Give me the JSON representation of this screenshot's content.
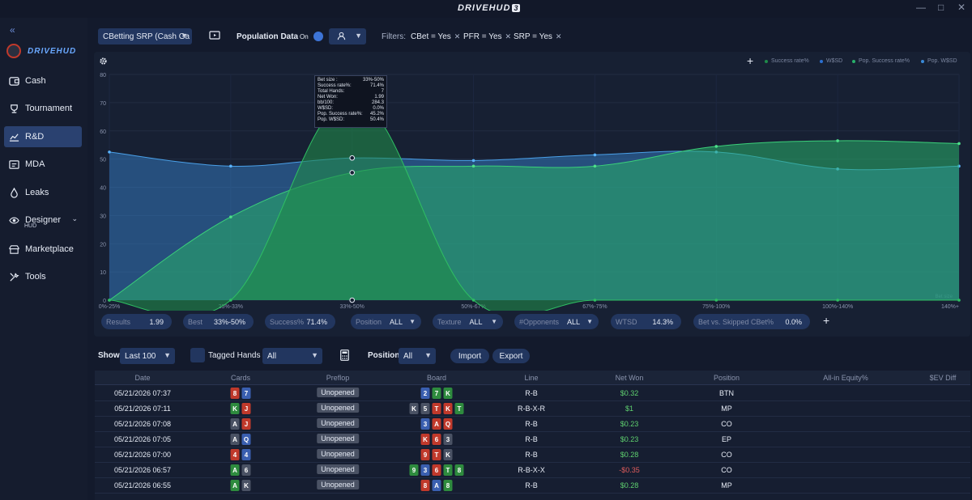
{
  "app": {
    "brand": "DRIVEHUD",
    "brand_version": "3",
    "side_logo_text": "DRIVEHUD"
  },
  "sidebar": {
    "items": [
      {
        "label": "Cash",
        "icon": "cash-icon"
      },
      {
        "label": "Tournament",
        "icon": "trophy-icon"
      },
      {
        "label": "R&D",
        "icon": "chart-icon",
        "active": true
      },
      {
        "label": "MDA",
        "icon": "mda-icon"
      },
      {
        "label": "Leaks",
        "icon": "drop-icon"
      },
      {
        "label": "Designer",
        "sub": "HUD",
        "icon": "eye-icon"
      },
      {
        "label": "Marketplace",
        "icon": "store-icon"
      },
      {
        "label": "Tools",
        "icon": "tools-icon"
      }
    ]
  },
  "topbar": {
    "report_select": "CBetting SRP (Cash Ga",
    "population_label": "Population Data",
    "population_toggle": "On",
    "filters_label": "Filters:",
    "filters": [
      "CBet = Yes",
      "PFR = Yes",
      "SRP = Yes"
    ]
  },
  "legend": [
    "Success rate%",
    "W$SD",
    "Pop. Success rate%",
    "Pop. W$SD"
  ],
  "tooltip": [
    [
      "Bet size :",
      "33%-50%"
    ],
    [
      "Success rate%:",
      "71.4%"
    ],
    [
      "Total Hands:",
      "7"
    ],
    [
      "Net Won:",
      "1.99"
    ],
    [
      "bb/100:",
      "284.3"
    ],
    [
      "W$SD:",
      "0.0%"
    ],
    [
      "Pop. Success rate%:",
      "45.2%"
    ],
    [
      "Pop. W$SD:",
      "50.4%"
    ]
  ],
  "chart_data": {
    "type": "area",
    "categories": [
      "0%-25%",
      "25%-33%",
      "33%-50%",
      "50%-67%",
      "67%-75%",
      "75%-100%",
      "100%-140%",
      "140%+"
    ],
    "x_axis_end_label": "Bet size",
    "ylim": [
      0,
      80
    ],
    "yticks": [
      0,
      10,
      20,
      30,
      40,
      50,
      60,
      70,
      80
    ],
    "series": [
      {
        "name": "Success rate%",
        "values": [
          0,
          0,
          71.4,
          0,
          0,
          0,
          0,
          0
        ],
        "color": "#1f8a4a"
      },
      {
        "name": "W$SD",
        "values": [
          0,
          0,
          0,
          0,
          0,
          0,
          0,
          0
        ],
        "color": "#2b6fd1"
      },
      {
        "name": "Pop. Success rate%",
        "values": [
          0,
          29.5,
          45.2,
          47.5,
          47.5,
          54.5,
          56.5,
          55.5
        ],
        "color": "#28b06a"
      },
      {
        "name": "Pop. W$SD",
        "values": [
          52.5,
          47.5,
          50.4,
          49.5,
          51.5,
          52.5,
          46.5,
          47.5
        ],
        "color": "#3a8ad8"
      }
    ],
    "grid": true
  },
  "stats": {
    "results_label": "Results",
    "results_value": "1.99",
    "best_label": "Best",
    "best_value": "33%-50%",
    "success_label": "Success%",
    "success_value": "71.4%",
    "position_label": "Position",
    "position_value": "ALL",
    "texture_label": "Texture",
    "texture_value": "ALL",
    "opponents_label": "#Opponents",
    "opponents_value": "ALL",
    "wtsd_label": "WTSD",
    "wtsd_value": "14.3%",
    "bvs_label": "Bet vs. Skipped CBet%",
    "bvs_value": "0.0%"
  },
  "toolbar": {
    "show_label": "Show",
    "show_value": "Last 100",
    "tagged_label": "Tagged Hands",
    "tagged_value": "All",
    "position_label": "Position",
    "position_value": "All",
    "import_label": "Import",
    "export_label": "Export"
  },
  "table": {
    "headers": [
      "Date",
      "Cards",
      "Preflop",
      "Board",
      "Line",
      "Net Won",
      "Position",
      "All-in Equity%",
      "$EV Diff"
    ],
    "rows": [
      {
        "date": "05/21/2026 07:37",
        "cards": [
          [
            "8",
            "#c0392b"
          ],
          [
            "7",
            "#3a5fb0"
          ]
        ],
        "preflop": "Unopened",
        "board": [
          [
            "2",
            "#3a5fb0"
          ],
          [
            "7",
            "#2e8b3e"
          ],
          [
            "K",
            "#2e8b3e"
          ]
        ],
        "line": "R-B",
        "net": "$0.32",
        "net_neg": false,
        "position": "BTN"
      },
      {
        "date": "05/21/2026 07:11",
        "cards": [
          [
            "K",
            "#2e8b3e"
          ],
          [
            "J",
            "#c0392b"
          ]
        ],
        "preflop": "Unopened",
        "board": [
          [
            "K",
            "#4a5264"
          ],
          [
            "5",
            "#4a5264"
          ],
          [
            "T",
            "#c0392b"
          ],
          [
            "K",
            "#c0392b"
          ],
          [
            "T",
            "#2e8b3e"
          ]
        ],
        "line": "R-B-X-R",
        "net": "$1",
        "net_neg": false,
        "position": "MP"
      },
      {
        "date": "05/21/2026 07:08",
        "cards": [
          [
            "A",
            "#4a5264"
          ],
          [
            "J",
            "#c0392b"
          ]
        ],
        "preflop": "Unopened",
        "board": [
          [
            "3",
            "#3a5fb0"
          ],
          [
            "A",
            "#c0392b"
          ],
          [
            "Q",
            "#c0392b"
          ]
        ],
        "line": "R-B",
        "net": "$0.23",
        "net_neg": false,
        "position": "CO"
      },
      {
        "date": "05/21/2026 07:05",
        "cards": [
          [
            "A",
            "#4a5264"
          ],
          [
            "Q",
            "#3a5fb0"
          ]
        ],
        "preflop": "Unopened",
        "board": [
          [
            "K",
            "#c0392b"
          ],
          [
            "6",
            "#c0392b"
          ],
          [
            "3",
            "#4a5264"
          ]
        ],
        "line": "R-B",
        "net": "$0.23",
        "net_neg": false,
        "position": "EP"
      },
      {
        "date": "05/21/2026 07:00",
        "cards": [
          [
            "4",
            "#c0392b"
          ],
          [
            "4",
            "#3a5fb0"
          ]
        ],
        "preflop": "Unopened",
        "board": [
          [
            "9",
            "#c0392b"
          ],
          [
            "T",
            "#c0392b"
          ],
          [
            "K",
            "#4a5264"
          ]
        ],
        "line": "R-B",
        "net": "$0.28",
        "net_neg": false,
        "position": "CO"
      },
      {
        "date": "05/21/2026 06:57",
        "cards": [
          [
            "A",
            "#2e8b3e"
          ],
          [
            "6",
            "#4a5264"
          ]
        ],
        "preflop": "Unopened",
        "board": [
          [
            "9",
            "#2e8b3e"
          ],
          [
            "3",
            "#3a5fb0"
          ],
          [
            "6",
            "#c0392b"
          ],
          [
            "T",
            "#2e8b3e"
          ],
          [
            "8",
            "#2e8b3e"
          ]
        ],
        "line": "R-B-X-X",
        "net": "-$0.35",
        "net_neg": true,
        "position": "CO"
      },
      {
        "date": "05/21/2026 06:55",
        "cards": [
          [
            "A",
            "#2e8b3e"
          ],
          [
            "K",
            "#4a5264"
          ]
        ],
        "preflop": "Unopened",
        "board": [
          [
            "8",
            "#c0392b"
          ],
          [
            "A",
            "#3a5fb0"
          ],
          [
            "8",
            "#2e8b3e"
          ]
        ],
        "line": "R-B",
        "net": "$0.28",
        "net_neg": false,
        "position": "MP"
      }
    ]
  }
}
